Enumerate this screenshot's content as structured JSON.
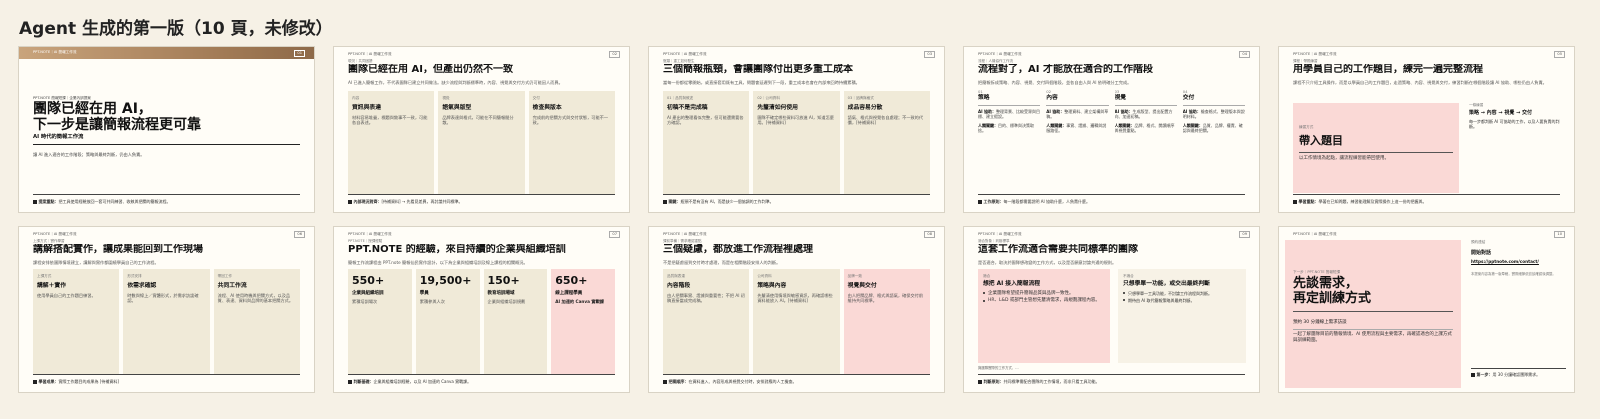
{
  "page_title": "Agent 生成的第一版（10 頁，未修改）",
  "brand": "PPT.NOTE｜AI 簡報工作流",
  "slides": [
    {
      "num": "01",
      "series_label": "PPT.NOTE 簡報短課｜企業內訓提案",
      "title_line1": "團隊已經在用 AI，",
      "title_line2": "下一步是讓簡報流程更可靠",
      "tagline": "AI 時代的簡報工作流",
      "desc": "讓 AI 進入適合的工作階段；策略與最終判斷，仍由人負責。",
      "foot_label": "提案重點：",
      "foot_text": "把工具使用經驗放回一套可共同練習、收斂與把關的簡報流程。"
    },
    {
      "num": "02",
      "kicker": "現況｜共同困擾",
      "title": "團隊已經在用 AI，但產出仍然不一致",
      "lead": "AI 已進入簡報工作，不代表團隊已建立共同做法。缺少流程與判斷標準時，內容、視覺與交付方式仍可能因人而異。",
      "cards": [
        {
          "label": "內容",
          "title": "資訊與表達",
          "body": "材料容易堆疊，標題與敘事不一致，可能各自表述。"
        },
        {
          "label": "視覺",
          "title": "語氣與版型",
          "body": "品牌表達與格式，可能在不同簡報間分散。"
        },
        {
          "label": "交付",
          "title": "檢查與版本",
          "body": "完成前的把關方式與交付狀態，可能不一致。"
        }
      ],
      "foot_label": "內部現況對齊：",
      "foot_text": "[待補資料] → 先看見差異，再討論共同標準。"
    },
    {
      "num": "03",
      "kicker": "瓶頸｜重工如何發生",
      "title": "三個簡報瓶頸，會讓團隊付出更多重工成本",
      "lead": "當每一份都從零開始，或直接套用既有工具，問題會延遲到下一段，重工成本也會在內部來回時持續累積。",
      "cards": [
        {
          "label": "01｜品質與敘述",
          "title": "初稿不是完成稿",
          "body": "AI 產出的整理看似完整，但可能還需要各方確認。"
        },
        {
          "label": "02｜公司資料",
          "title": "先釐清如何使用",
          "body": "團隊不確定哪些資料可放進 AI，知道怎麼用。[待補資料]"
        },
        {
          "label": "03｜品牌與格式",
          "title": "成品容易分散",
          "body": "語氣、格式與視覺各自處理；不一致的代價，[待補資料]"
        }
      ],
      "foot_label": "關鍵：",
      "foot_text": "瓶頸不是有沒有 AI，而是缺少一個協調的工作判準。"
    },
    {
      "num": "04",
      "kicker": "流程｜人機協作工作流",
      "title": "流程對了，AI 才能放在適合的工作階段",
      "lead": "把簡報拆成策略、內容、視覺、交付四個階段，並各自由人與 AI 依明確分工完成。",
      "cols": [
        {
          "num": "01",
          "title": "策略",
          "ai": "AI 協助：",
          "ai_body": "整理背景、比較受眾與目標、建立假設。",
          "human": "人類關鍵：",
          "human_body": "目的、標準與決策取捨。"
        },
        {
          "num": "02",
          "title": "內容",
          "ai": "AI 協助：",
          "ai_body": "整理資料、建立架構與草稿。",
          "human": "人類關鍵：",
          "human_body": "事實、證據、邏輯與說服路徑。"
        },
        {
          "num": "03",
          "title": "視覺",
          "ai": "AI 協助：",
          "ai_body": "生成版型、提出配置方向、加速初稿。",
          "human": "人類關鍵：",
          "human_body": "品牌、格式、閱讀順序與視覺重點。"
        },
        {
          "num": "04",
          "title": "交付",
          "ai": "AI 協助：",
          "ai_body": "檢查格式、整理版本與說明材料。",
          "human": "人類關鍵：",
          "human_body": "品質、品牌、權責、確認與最終把關。"
        }
      ],
      "foot_label": "工作原則：",
      "foot_text": "每一階段都需要說明 AI 協助什麼，人負責什麼。"
    },
    {
      "num": "05",
      "kicker": "課程｜帶題練習",
      "title": "用學員自己的工作題目，練完一遍完整流程",
      "lead": "課程不只介紹工具操作，而是以學員自己的工作題目，走過策略、內容、視覺與交付，練習判斷在哪個階段讓 AI 協助、哪些仍由人負責。",
      "box_label": "練習方式",
      "box_title": "帶入題目",
      "box_body": "以工作情境為起點，讓流程練習能帶回使用。",
      "side_label": "一條練習",
      "side_flow": "策略 → 內容 → 視覺 → 交付",
      "side_body": "每一步都判斷 AI 可協助的工作，以及人要負責的判斷。",
      "foot_label": "學習重點：",
      "foot_text": "學著在已知問題，練習能理解及實際操作上這一份的把握與。"
    },
    {
      "num": "06",
      "kicker": "上課方式｜實作學習",
      "title": "講解搭配實作，讓成果能回到工作現場",
      "lead": "課程安排依團隊情境建立，講解與實作都圍繞學員自己的工作流程。",
      "cards": [
        {
          "label": "上課方式",
          "title": "講解＋實作",
          "body": "使用學員自己的工作題目練習。"
        },
        {
          "label": "形式安排",
          "title": "依需求確認",
          "body": "時數與線上／實體形式，於需求訪談確認。"
        },
        {
          "label": "帶回工作",
          "title": "共同工作流",
          "body": "流程、AI 使用時機與把關方式，以及品質、表達、資料與品牌的基本把關方式。"
        }
      ],
      "foot_label": "學習成果：",
      "foot_text": "實際工作題目的成果為 [待補資料]"
    },
    {
      "num": "07",
      "kicker": "PPT.NOTE｜授課經驗",
      "title": "PPT.NOTE 的經驗，來自持續的企業與組織培訓",
      "lead": "簡報工作流課程由 PPT.note 簡報仙民實作設計，以下為企業與組織培訓及線上課程的相關概況。",
      "stats": [
        {
          "num": "550+",
          "title": "企業與組織培訓",
          "body": "累積培訓場次"
        },
        {
          "num": "19,500+",
          "title": "學員",
          "body": "累積參與人次"
        },
        {
          "num": "150+",
          "title": "教育培訓場域",
          "body": "企業與組織培訓規劃"
        },
        {
          "num": "650+",
          "title": "線上課程學員",
          "body": "AI 加速的 Canva 實戰課"
        }
      ],
      "foot_label": "判斷基礎：",
      "foot_text": "企業與組織培訓經驗，以及 AI 加速的 Canva 實戰課。"
    },
    {
      "num": "08",
      "kicker": "課前準備｜需求確認重點",
      "title": "三個疑慮，都放進工作流程裡處理",
      "lead": "不是把疑慮留到交付時才處理，而是在相關階段安排人的判斷。",
      "cards": [
        {
          "label": "品質與表達",
          "title": "內容階段",
          "body": "由人把關事實、證據與重要性；不把 AI 初稿直接當成完成稿。"
        },
        {
          "label": "公司資料",
          "title": "策略與內容",
          "body": "先釐清使用情境與敏感資訊，再確認哪些資料能放入 AI。[待補資料]"
        },
        {
          "label": "品牌一致",
          "title": "視覺與交付",
          "body": "由人把關品牌、格式與語氣，確保交付前維持共同標準。"
        }
      ],
      "foot_label": "把關順序：",
      "foot_text": "在資料進入、內容形成與視覺交付時，安排對應的人工檢查。"
    },
    {
      "num": "09",
      "kicker": "適合對象｜判斷標準",
      "title": "這套工作流適合需要共同標準的團隊",
      "lead": "是否適合，取決於團隊想改變的工作方式，以及是否願意討論共通的規則。",
      "fit_label": "適合",
      "fit_title": "想把 AI 接入簡報流程",
      "fit_items": [
        "企業團隊希望提升簡報品質與品牌一致性。",
        "HR、L&D 或部門主管想先釐清需求，再規劃課程內容。"
      ],
      "fit_foot": "與團隊實際的工作方式，…",
      "unfit_label": "不適合",
      "unfit_title": "只想學單一功能，或交出最終判斷",
      "unfit_items": [
        "只想學單一工具功能，不討論工作流程與判斷。",
        "期待由 AI 取代簡報策略與最終判斷。"
      ],
      "foot_label": "判斷原則：",
      "foot_text": "共同標準需配合團隊的工作情境，而非只看工具功能。"
    },
    {
      "num": "10",
      "kicker": "下一步｜PPT.NOTE 簡報短課",
      "title_line1": "先談需求，",
      "title_line2": "再定訓練方式",
      "box_label": "預約 30 分鐘線上需求訪談",
      "box_body": "一起了解團隊目前的簡報情境、AI 使用流程與主要需求，再確認適合的上課方式與訓練範圍。",
      "side_label": "預約連結",
      "side_title": "開始對話",
      "side_link": "https://pptnote.com/contact/",
      "side_body": "本提案內容為第一版草稿，實際細節依訪談確認後調整。",
      "foot_label": "第一步：",
      "foot_text": "用 30 分鐘確認團隊需求。"
    }
  ]
}
